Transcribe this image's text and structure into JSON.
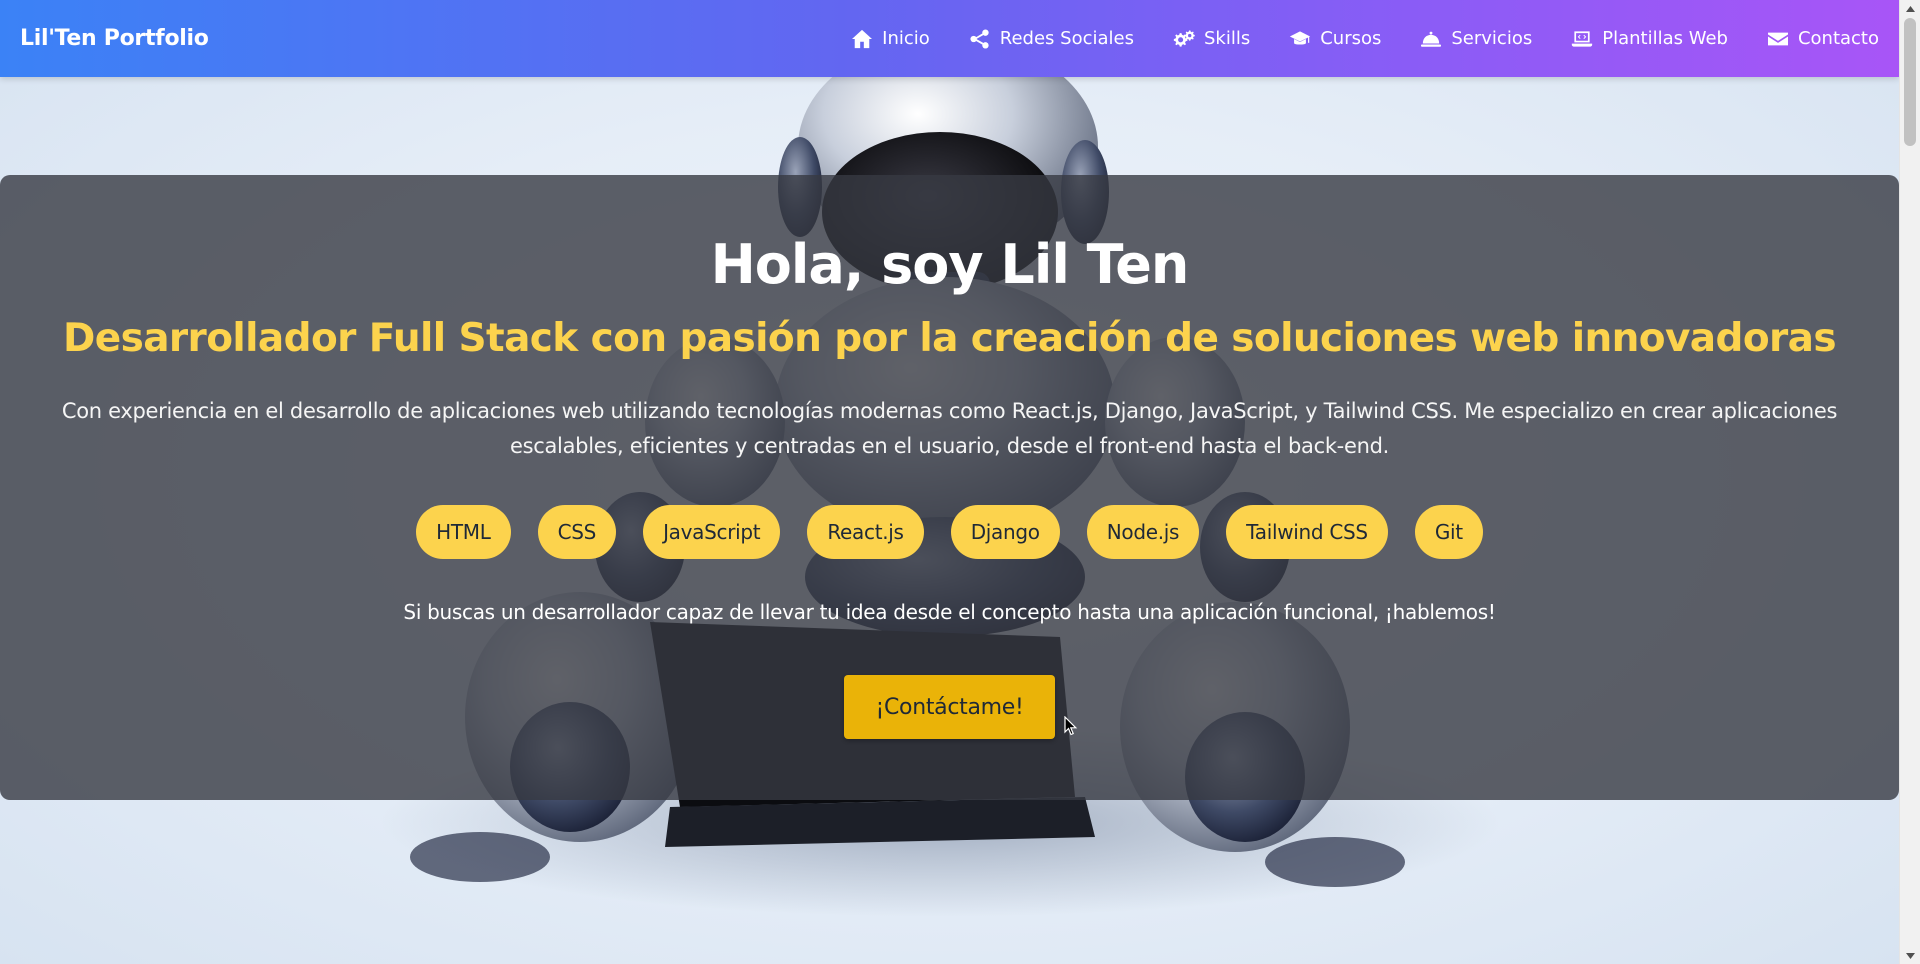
{
  "navbar": {
    "brand": "Lil'Ten Portfolio",
    "items": [
      {
        "label": "Inicio",
        "icon": "home-icon"
      },
      {
        "label": "Redes Sociales",
        "icon": "share-icon"
      },
      {
        "label": "Skills",
        "icon": "gears-icon"
      },
      {
        "label": "Cursos",
        "icon": "graduation-cap-icon"
      },
      {
        "label": "Servicios",
        "icon": "concierge-bell-icon"
      },
      {
        "label": "Plantillas Web",
        "icon": "laptop-code-icon"
      },
      {
        "label": "Contacto",
        "icon": "envelope-icon"
      }
    ]
  },
  "hero": {
    "title": "Hola, soy Lil Ten",
    "subtitle": "Desarrollador Full Stack con pasión por la creación de soluciones web innovadoras",
    "description": "Con experiencia en el desarrollo de aplicaciones web utilizando tecnologías modernas como React.js, Django, JavaScript, y Tailwind CSS. Me especializo en crear aplicaciones escalables, eficientes y centradas en el usuario, desde el front-end hasta el back-end.",
    "technologies": [
      "HTML",
      "CSS",
      "JavaScript",
      "React.js",
      "Django",
      "Node.js",
      "Tailwind CSS",
      "Git"
    ],
    "cta_text": "Si buscas un desarrollador capaz de llevar tu idea desde el concepto hasta una aplicación funcional, ¡hablemos!",
    "cta_button": "¡Contáctame!",
    "background_image": "robot-with-laptop-illustration"
  },
  "colors": {
    "navbar_gradient": [
      "#3b82f6",
      "#6366f1",
      "#a855f7"
    ],
    "accent_yellow": "#fcd34d",
    "button_yellow": "#eab308",
    "overlay": "#373a42"
  }
}
